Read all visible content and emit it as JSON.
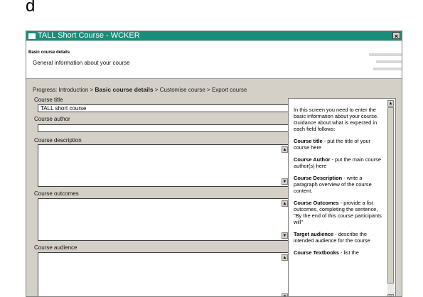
{
  "figure_label": "d",
  "window": {
    "title": "TALL Short Course - WCKER",
    "close_glyph": "×"
  },
  "header": {
    "title": "Basic course details",
    "subtitle": "General information about your course"
  },
  "progress": {
    "prefix": "Progress:",
    "steps": [
      "Introduction",
      "Basic course details",
      "Customise course",
      "Export course"
    ],
    "separator": ">",
    "current_index": 1
  },
  "form": {
    "course_title": {
      "label": "Course title",
      "value": "TALL short course"
    },
    "course_author": {
      "label": "Course author",
      "value": ""
    },
    "course_description": {
      "label": "Course description",
      "value": ""
    },
    "course_outcomes": {
      "label": "Course outcomes",
      "value": ""
    },
    "course_audience": {
      "label": "Course audience",
      "value": ""
    }
  },
  "help": {
    "intro": "In this screen you need to enter the basic information about your course. Guidance about what is expected in each field follows:",
    "items": [
      {
        "term": "Course title",
        "text": " - put the title of your course here"
      },
      {
        "term": "Course Author",
        "text": " - put the main course author(s) here"
      },
      {
        "term": "Course Description",
        "text": " - write a paragraph overview of the course content."
      },
      {
        "term": "Course Outcomes",
        "text": " - provide a list outcomes, completing the sentence, \"By the end of this course participants will\""
      },
      {
        "term": "Target audience",
        "text": " - describe the intended audience for the course"
      },
      {
        "term": "Course Textbooks",
        "text": " - list the"
      }
    ]
  },
  "colors": {
    "titlebar": "#1a8c7a",
    "window_bg": "#d4d0c8"
  }
}
